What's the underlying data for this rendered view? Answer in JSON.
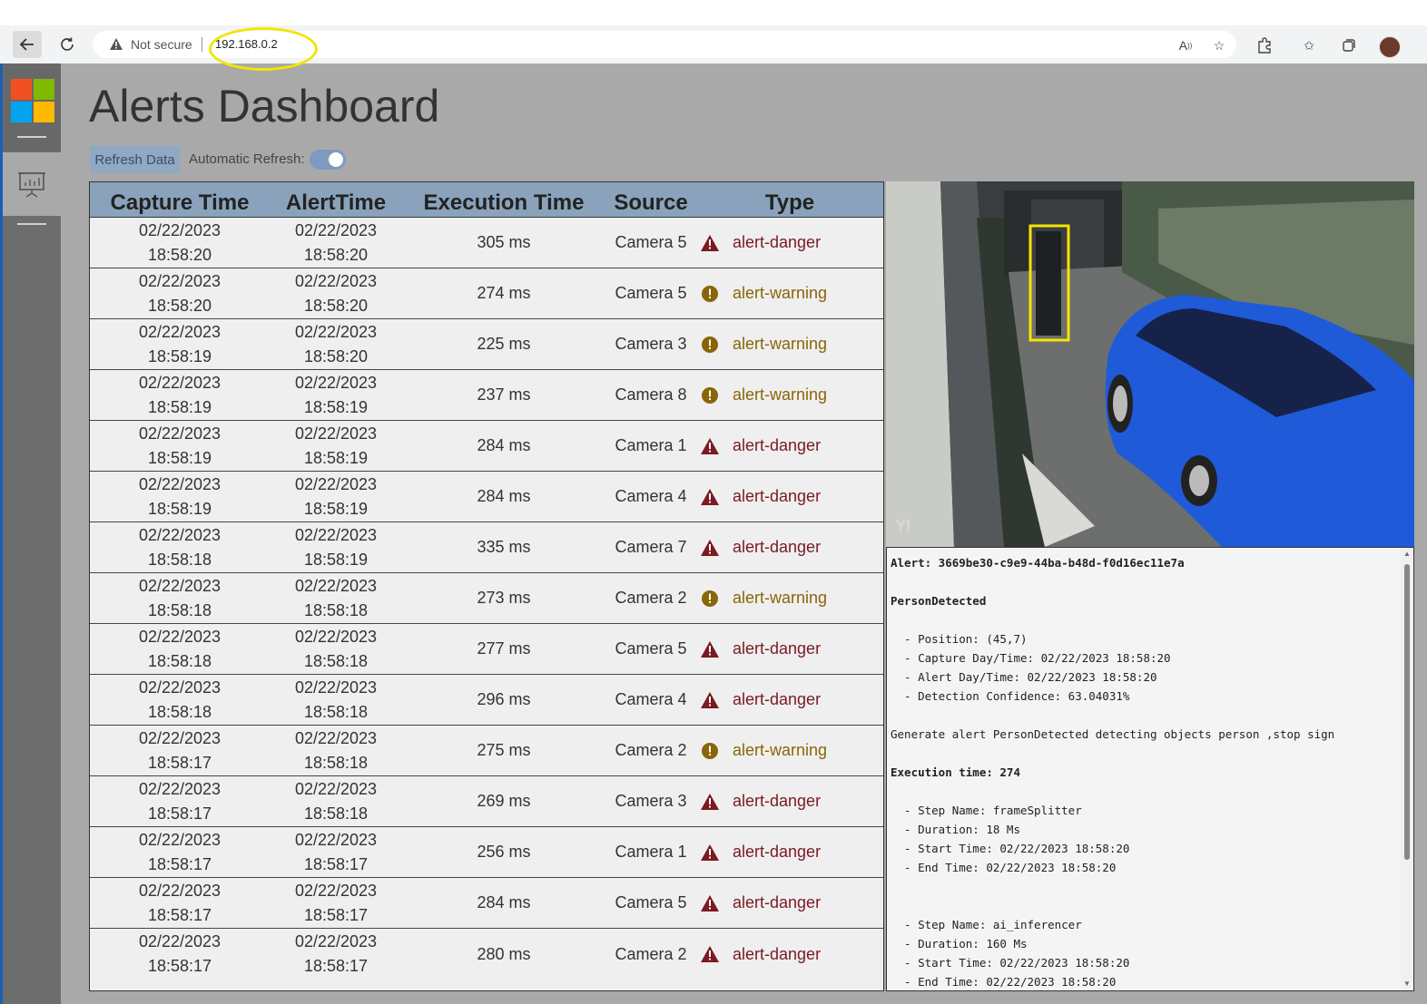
{
  "browser": {
    "security_label": "Not secure",
    "url": "192.168.0.2"
  },
  "page": {
    "title": "Alerts Dashboard",
    "refresh_button": "Refresh Data",
    "auto_refresh_label": "Automatic Refresh:",
    "auto_refresh_on": true
  },
  "colors": {
    "header_bg": "#8aa2bb",
    "danger": "#7a1a22",
    "warning": "#8a6508",
    "ms_red": "#f25022",
    "ms_green": "#7fba00",
    "ms_blue": "#00a4ef",
    "ms_yellow": "#ffb900"
  },
  "table": {
    "headers": [
      "Capture Time",
      "AlertTime",
      "Execution Time",
      "Source",
      "Type"
    ],
    "rows": [
      {
        "capture_date": "02/22/2023",
        "capture_time": "18:58:20",
        "alert_date": "02/22/2023",
        "alert_time": "18:58:20",
        "exec": "305 ms",
        "source": "Camera 5",
        "type": "alert-danger"
      },
      {
        "capture_date": "02/22/2023",
        "capture_time": "18:58:20",
        "alert_date": "02/22/2023",
        "alert_time": "18:58:20",
        "exec": "274 ms",
        "source": "Camera 5",
        "type": "alert-warning"
      },
      {
        "capture_date": "02/22/2023",
        "capture_time": "18:58:19",
        "alert_date": "02/22/2023",
        "alert_time": "18:58:20",
        "exec": "225 ms",
        "source": "Camera 3",
        "type": "alert-warning"
      },
      {
        "capture_date": "02/22/2023",
        "capture_time": "18:58:19",
        "alert_date": "02/22/2023",
        "alert_time": "18:58:19",
        "exec": "237 ms",
        "source": "Camera 8",
        "type": "alert-warning"
      },
      {
        "capture_date": "02/22/2023",
        "capture_time": "18:58:19",
        "alert_date": "02/22/2023",
        "alert_time": "18:58:19",
        "exec": "284 ms",
        "source": "Camera 1",
        "type": "alert-danger"
      },
      {
        "capture_date": "02/22/2023",
        "capture_time": "18:58:19",
        "alert_date": "02/22/2023",
        "alert_time": "18:58:19",
        "exec": "284 ms",
        "source": "Camera 4",
        "type": "alert-danger"
      },
      {
        "capture_date": "02/22/2023",
        "capture_time": "18:58:18",
        "alert_date": "02/22/2023",
        "alert_time": "18:58:19",
        "exec": "335 ms",
        "source": "Camera 7",
        "type": "alert-danger"
      },
      {
        "capture_date": "02/22/2023",
        "capture_time": "18:58:18",
        "alert_date": "02/22/2023",
        "alert_time": "18:58:18",
        "exec": "273 ms",
        "source": "Camera 2",
        "type": "alert-warning"
      },
      {
        "capture_date": "02/22/2023",
        "capture_time": "18:58:18",
        "alert_date": "02/22/2023",
        "alert_time": "18:58:18",
        "exec": "277 ms",
        "source": "Camera 5",
        "type": "alert-danger"
      },
      {
        "capture_date": "02/22/2023",
        "capture_time": "18:58:18",
        "alert_date": "02/22/2023",
        "alert_time": "18:58:18",
        "exec": "296 ms",
        "source": "Camera 4",
        "type": "alert-danger"
      },
      {
        "capture_date": "02/22/2023",
        "capture_time": "18:58:17",
        "alert_date": "02/22/2023",
        "alert_time": "18:58:18",
        "exec": "275 ms",
        "source": "Camera 2",
        "type": "alert-warning"
      },
      {
        "capture_date": "02/22/2023",
        "capture_time": "18:58:17",
        "alert_date": "02/22/2023",
        "alert_time": "18:58:18",
        "exec": "269 ms",
        "source": "Camera 3",
        "type": "alert-danger"
      },
      {
        "capture_date": "02/22/2023",
        "capture_time": "18:58:17",
        "alert_date": "02/22/2023",
        "alert_time": "18:58:17",
        "exec": "256 ms",
        "source": "Camera 1",
        "type": "alert-danger"
      },
      {
        "capture_date": "02/22/2023",
        "capture_time": "18:58:17",
        "alert_date": "02/22/2023",
        "alert_time": "18:58:17",
        "exec": "284 ms",
        "source": "Camera 5",
        "type": "alert-danger"
      },
      {
        "capture_date": "02/22/2023",
        "capture_time": "18:58:17",
        "alert_date": "02/22/2023",
        "alert_time": "18:58:17",
        "exec": "280 ms",
        "source": "Camera 2",
        "type": "alert-danger"
      }
    ]
  },
  "camera": {
    "watermark": "YI"
  },
  "detail": {
    "alert_line": "Alert: 3669be30-c9e9-44ba-b48d-f0d16ec11e7a",
    "event": "PersonDetected",
    "position": "  - Position: (45,7)",
    "capture": "  - Capture Day/Time: 02/22/2023 18:58:20",
    "alert_dt": "  - Alert Day/Time: 02/22/2023 18:58:20",
    "confidence": "  - Detection Confidence: 63.04031%",
    "generate": "Generate alert PersonDetected detecting objects person ,stop sign",
    "exec_time": "Execution time: 274",
    "step1_name": "  - Step Name: frameSplitter",
    "step1_duration": "  - Duration: 18 Ms",
    "step1_start": "  - Start Time: 02/22/2023 18:58:20",
    "step1_end": "  - End Time: 02/22/2023 18:58:20",
    "step2_name": "  - Step Name: ai_inferencer",
    "step2_duration": "  - Duration: 160 Ms",
    "step2_start": "  - Start Time: 02/22/2023 18:58:20",
    "step2_end": "  - End Time: 02/22/2023 18:58:20"
  }
}
